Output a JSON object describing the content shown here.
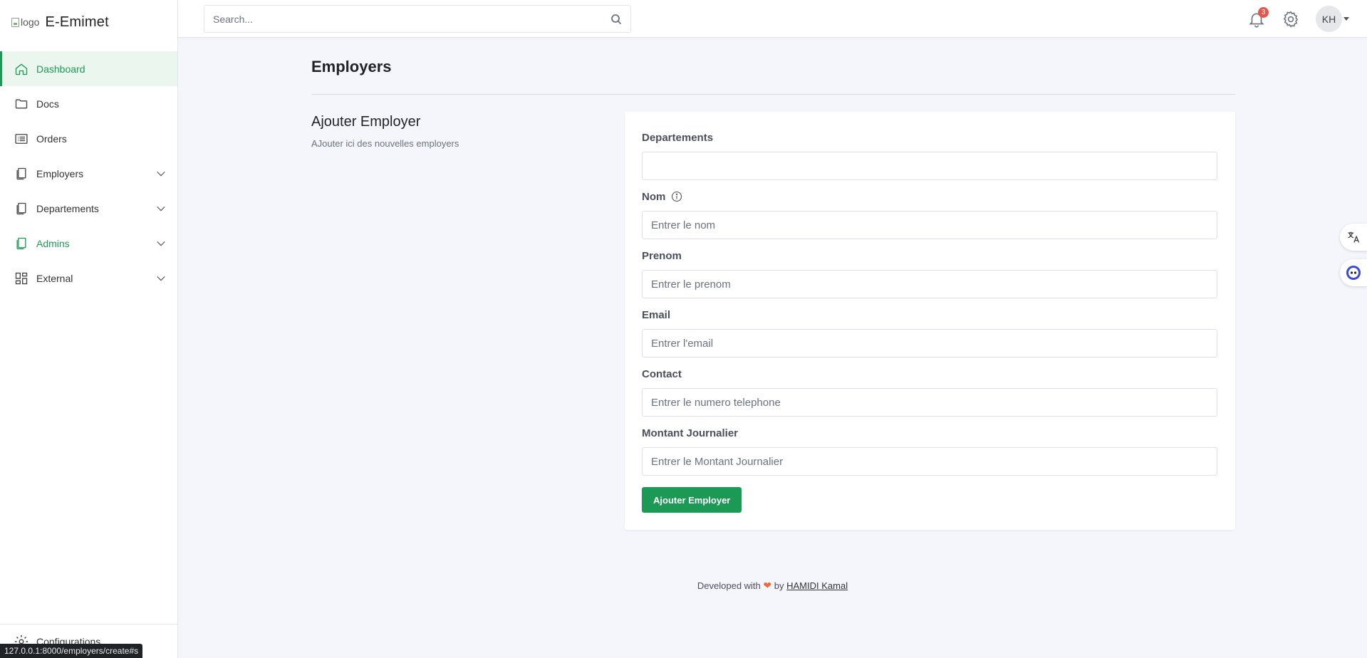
{
  "brand": {
    "logo_alt": "logo",
    "name": "E-Emimet"
  },
  "sidebar": {
    "items": [
      {
        "label": "Dashboard",
        "icon": "home-icon"
      },
      {
        "label": "Docs",
        "icon": "folder-icon"
      },
      {
        "label": "Orders",
        "icon": "list-icon"
      },
      {
        "label": "Employers",
        "icon": "pages-icon"
      },
      {
        "label": "Departements",
        "icon": "pages-icon"
      },
      {
        "label": "Admins",
        "icon": "pages-icon"
      },
      {
        "label": "External",
        "icon": "grid-icon"
      }
    ],
    "bottom_label": "Configurations"
  },
  "topbar": {
    "search_placeholder": "Search...",
    "notification_count": "3",
    "avatar_initials": "KH"
  },
  "page": {
    "title": "Employers",
    "section_title": "Ajouter Employer",
    "section_subtitle": "AJouter ici des nouvelles employers"
  },
  "form": {
    "departements_label": "Departements",
    "nom_label": "Nom",
    "nom_placeholder": "Entrer le nom",
    "prenom_label": "Prenom",
    "prenom_placeholder": "Entrer le prenom",
    "email_label": "Email",
    "email_placeholder": "Entrer l'email",
    "contact_label": "Contact",
    "contact_placeholder": "Entrer le numero telephone",
    "montant_label": "Montant Journalier",
    "montant_placeholder": "Entrer le Montant Journalier",
    "submit_label": "Ajouter Employer"
  },
  "footer": {
    "prefix": "Developed with",
    "by": "by",
    "author": "HAMIDI Kamal"
  },
  "status_url": "127.0.0.1:8000/employers/create#s",
  "colors": {
    "accent": "#1c9a55",
    "badge": "#e0574f",
    "background": "#f5f6fb"
  }
}
